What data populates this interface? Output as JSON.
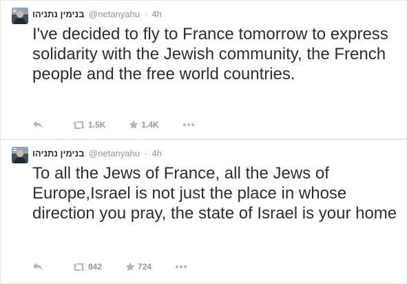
{
  "tweets": [
    {
      "author_name": "בנימין נתניהו",
      "handle": "@netanyahu",
      "separator": "·",
      "time": "4h",
      "text": "I've decided to fly to France tomorrow to express solidarity with the Jewish community, the French people and the free world countries.",
      "retweets": "1.5K",
      "favorites": "1.4K"
    },
    {
      "author_name": "בנימין נתניהו",
      "handle": "@netanyahu",
      "separator": "·",
      "time": "4h",
      "text": "To all the Jews of France, all the Jews of Europe,Israel is not just the place in whose direction you pray, the state of Israel is your home",
      "retweets": "842",
      "favorites": "724"
    }
  ],
  "icons": {
    "reply": "reply-icon",
    "retweet": "retweet-icon",
    "favorite": "star-icon",
    "more": "more-dots-icon"
  },
  "colors": {
    "text": "#292f33",
    "secondary": "#8899a6",
    "action_icon": "#aab8c2",
    "border": "#e1e8ed"
  }
}
